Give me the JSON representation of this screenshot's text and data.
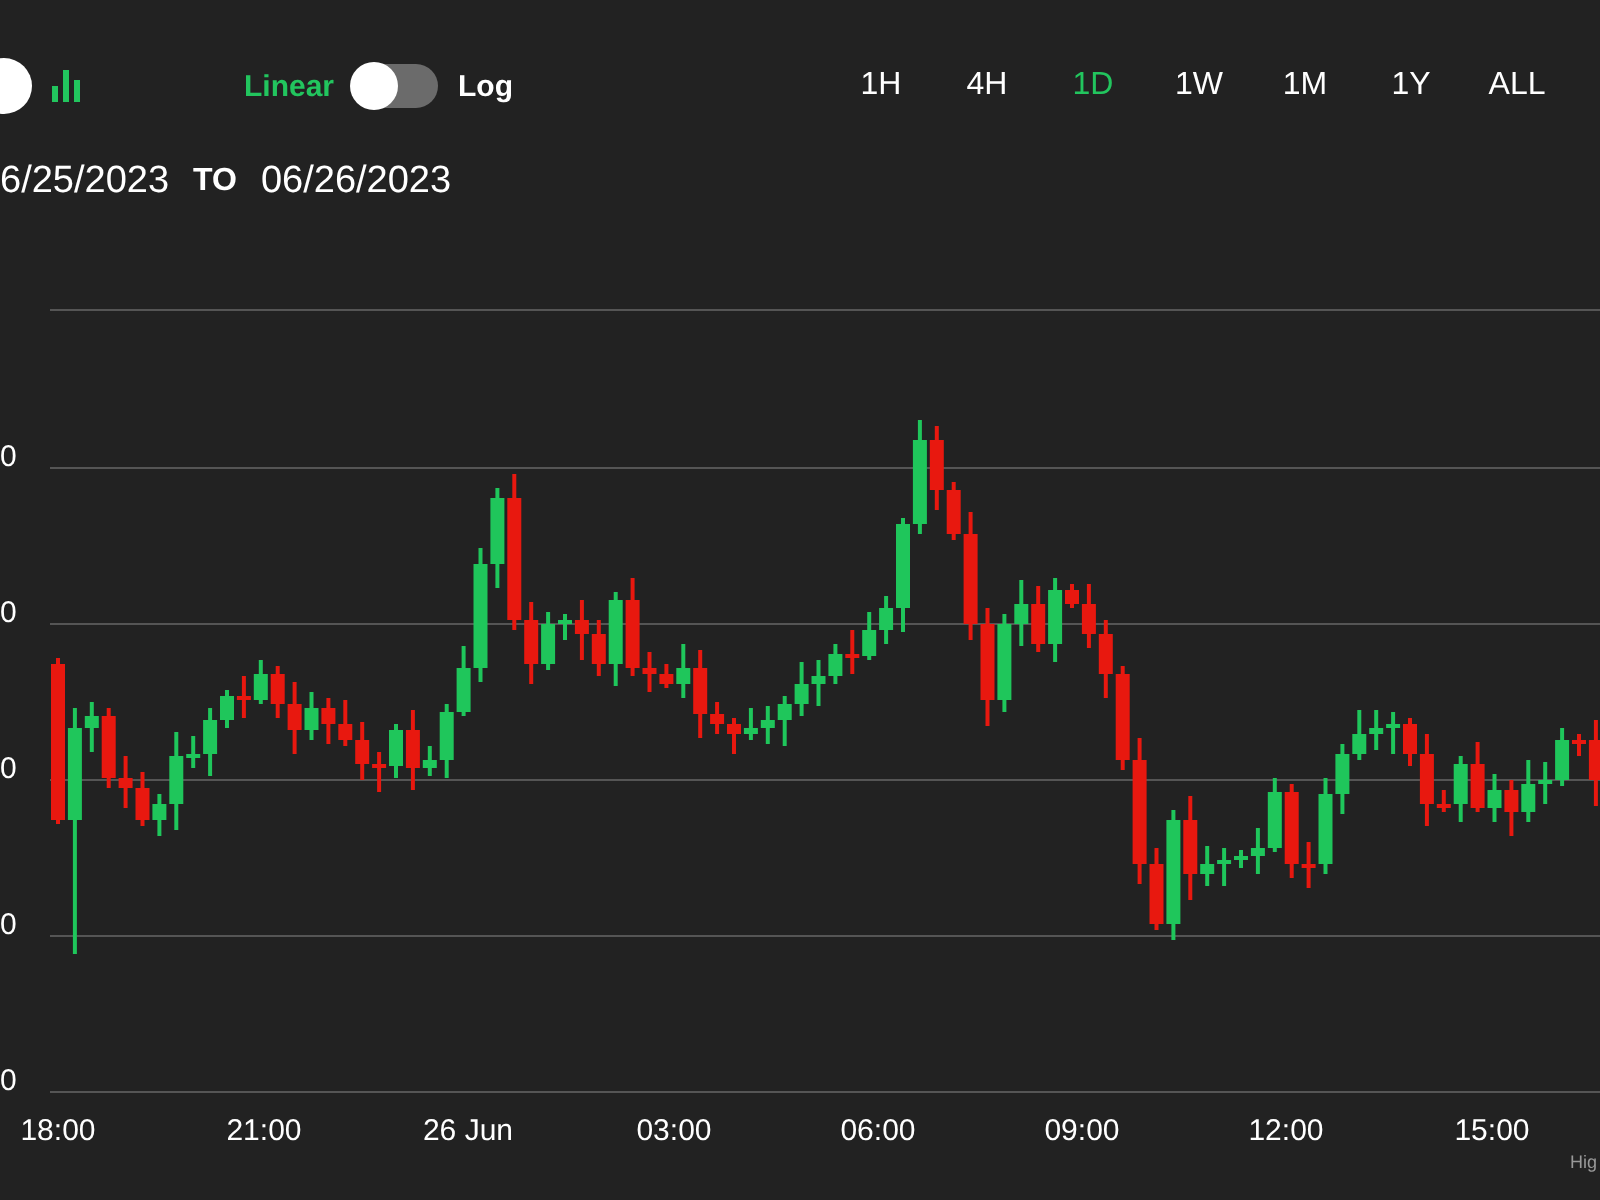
{
  "chart_type_toggle": {
    "on": true
  },
  "scale": [
    {
      "label": "Linear",
      "selected": true
    },
    {
      "label": "Log",
      "selected": false
    }
  ],
  "timeframes": [
    {
      "label": "1H",
      "selected": false
    },
    {
      "label": "4H",
      "selected": false
    },
    {
      "label": "1D",
      "selected": true
    },
    {
      "label": "1W",
      "selected": false
    },
    {
      "label": "1M",
      "selected": false
    },
    {
      "label": "1Y",
      "selected": false
    },
    {
      "label": "ALL",
      "selected": false
    }
  ],
  "date_range": {
    "from": "6/25/2023",
    "separator": "TO",
    "to": "06/26/2023"
  },
  "chart": {
    "y_labels": [
      "0",
      "0",
      "0",
      "0",
      "0"
    ],
    "x_labels": [
      "18:00",
      "21:00",
      "26 Jun",
      "03:00",
      "06:00",
      "09:00",
      "12:00",
      "15:00"
    ],
    "credits": "Hig"
  }
}
